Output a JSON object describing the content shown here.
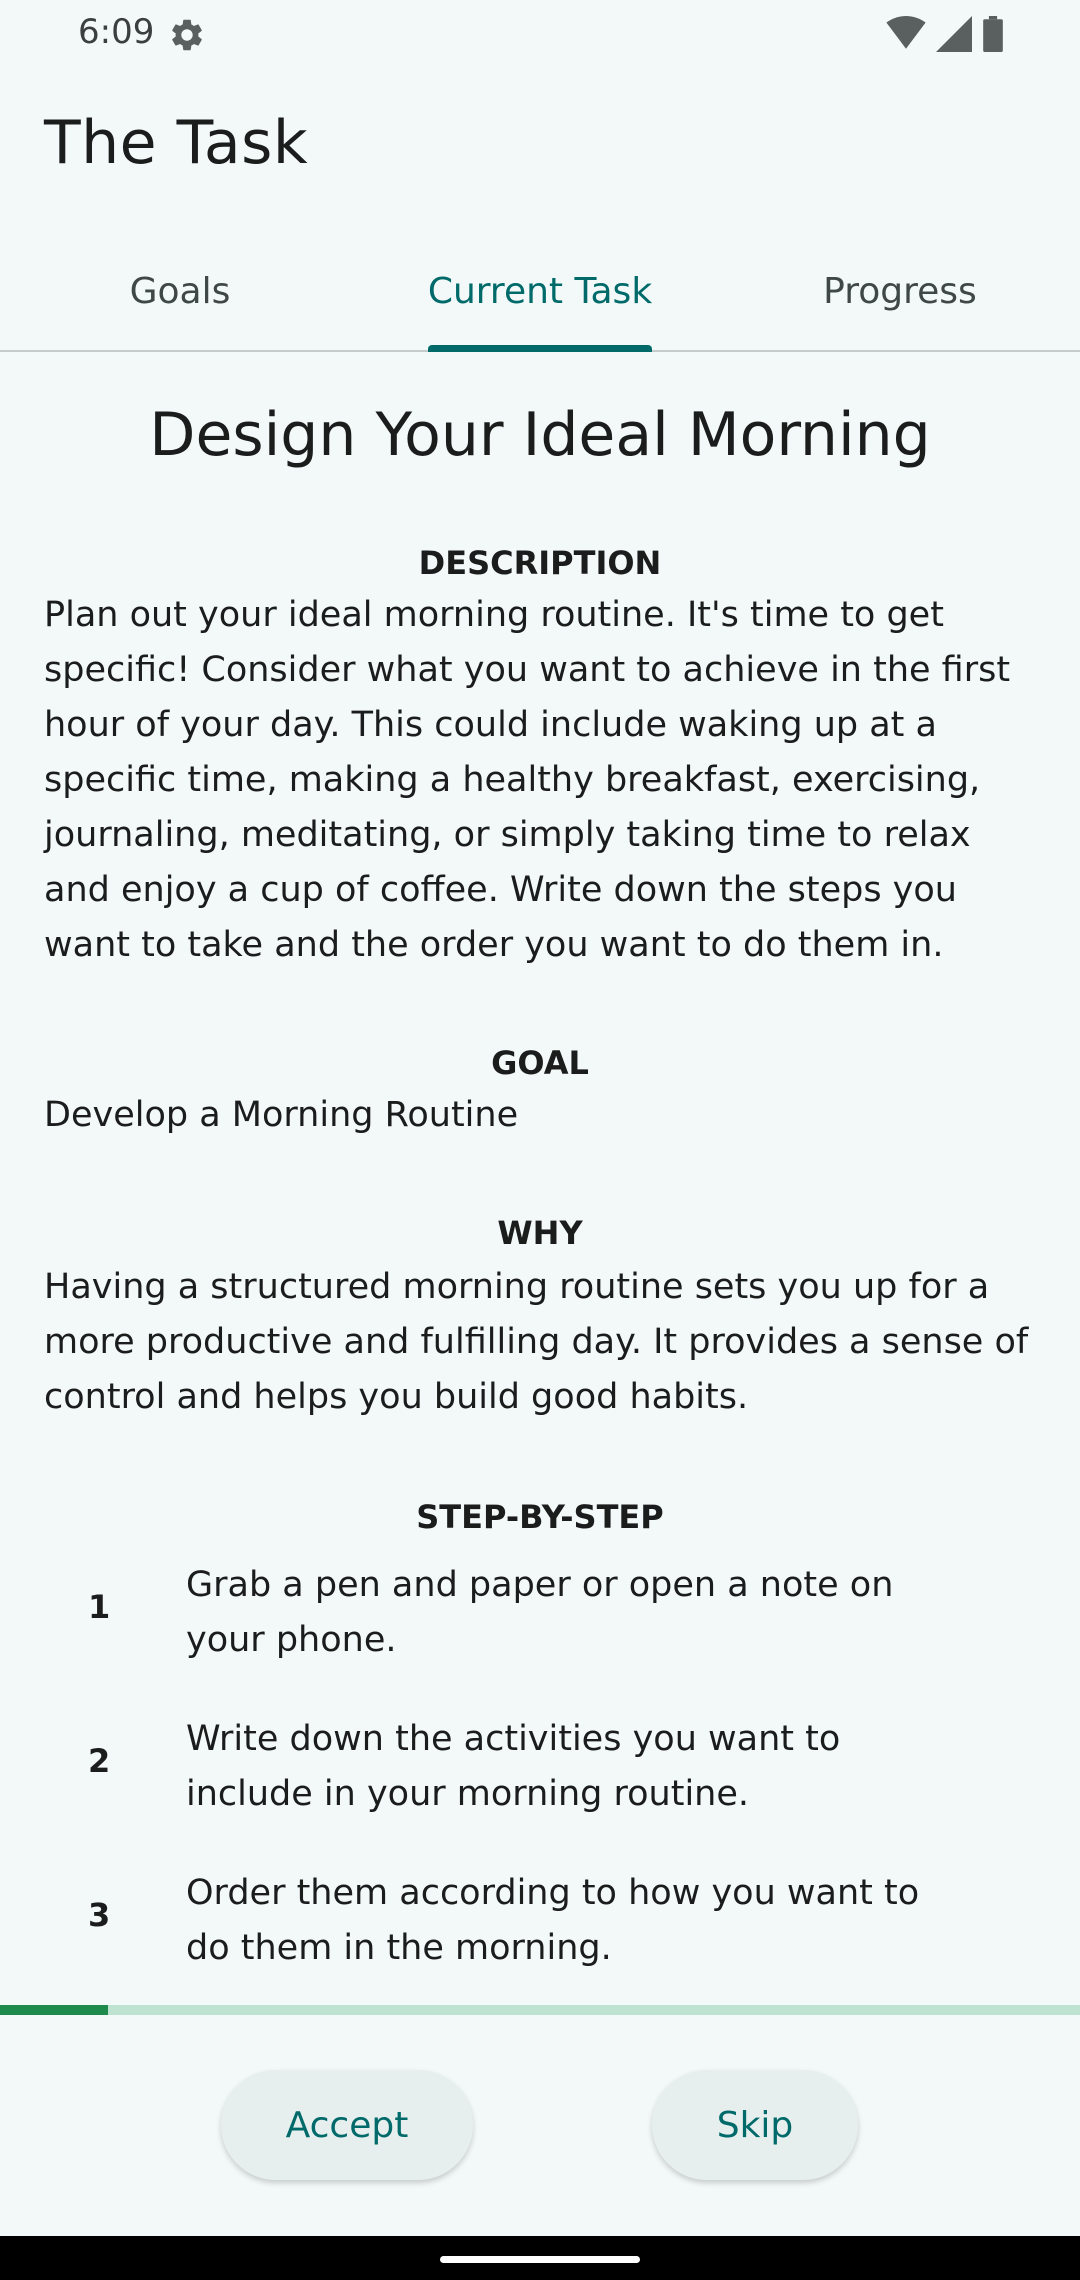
{
  "status_bar": {
    "time": "6:09",
    "icons": [
      "gear-icon",
      "wifi-icon",
      "signal-icon",
      "battery-icon"
    ]
  },
  "app_bar": {
    "title": "The Task"
  },
  "tabs": [
    {
      "label": "Goals",
      "active": false
    },
    {
      "label": "Current Task",
      "active": true
    },
    {
      "label": "Progress",
      "active": false
    }
  ],
  "task": {
    "title": "Design Your Ideal Morning",
    "description_heading": "DESCRIPTION",
    "description": "Plan out your ideal morning routine. It's time to get specific! Consider what you want to achieve in the first hour of your day. This could include waking up at a specific time, making a healthy breakfast, exercising, journaling, meditating, or simply taking time to relax and enjoy a cup of coffee. Write down the steps you want to take and the order you want to do them in.",
    "goal_heading": "GOAL",
    "goal": "Develop a Morning Routine",
    "why_heading": "WHY",
    "why": "Having a structured morning routine sets you up for a more productive and fulfilling day. It provides a sense of control and helps you build good habits.",
    "steps_heading": "STEP-BY-STEP",
    "steps": [
      {
        "number": "1",
        "text": "Grab a pen and paper or open a note on your phone."
      },
      {
        "number": "2",
        "text": "Write down the activities you want to include in your morning routine."
      },
      {
        "number": "3",
        "text": "Order them according to how you want to do them in the morning."
      }
    ]
  },
  "progress": {
    "fraction": 0.1
  },
  "actions": {
    "accept_label": "Accept",
    "skip_label": "Skip"
  },
  "colors": {
    "accent": "#006a6a",
    "progress_fill": "#1e8a4c",
    "progress_track": "#bfe3d1",
    "background": "#f3f9f8"
  }
}
